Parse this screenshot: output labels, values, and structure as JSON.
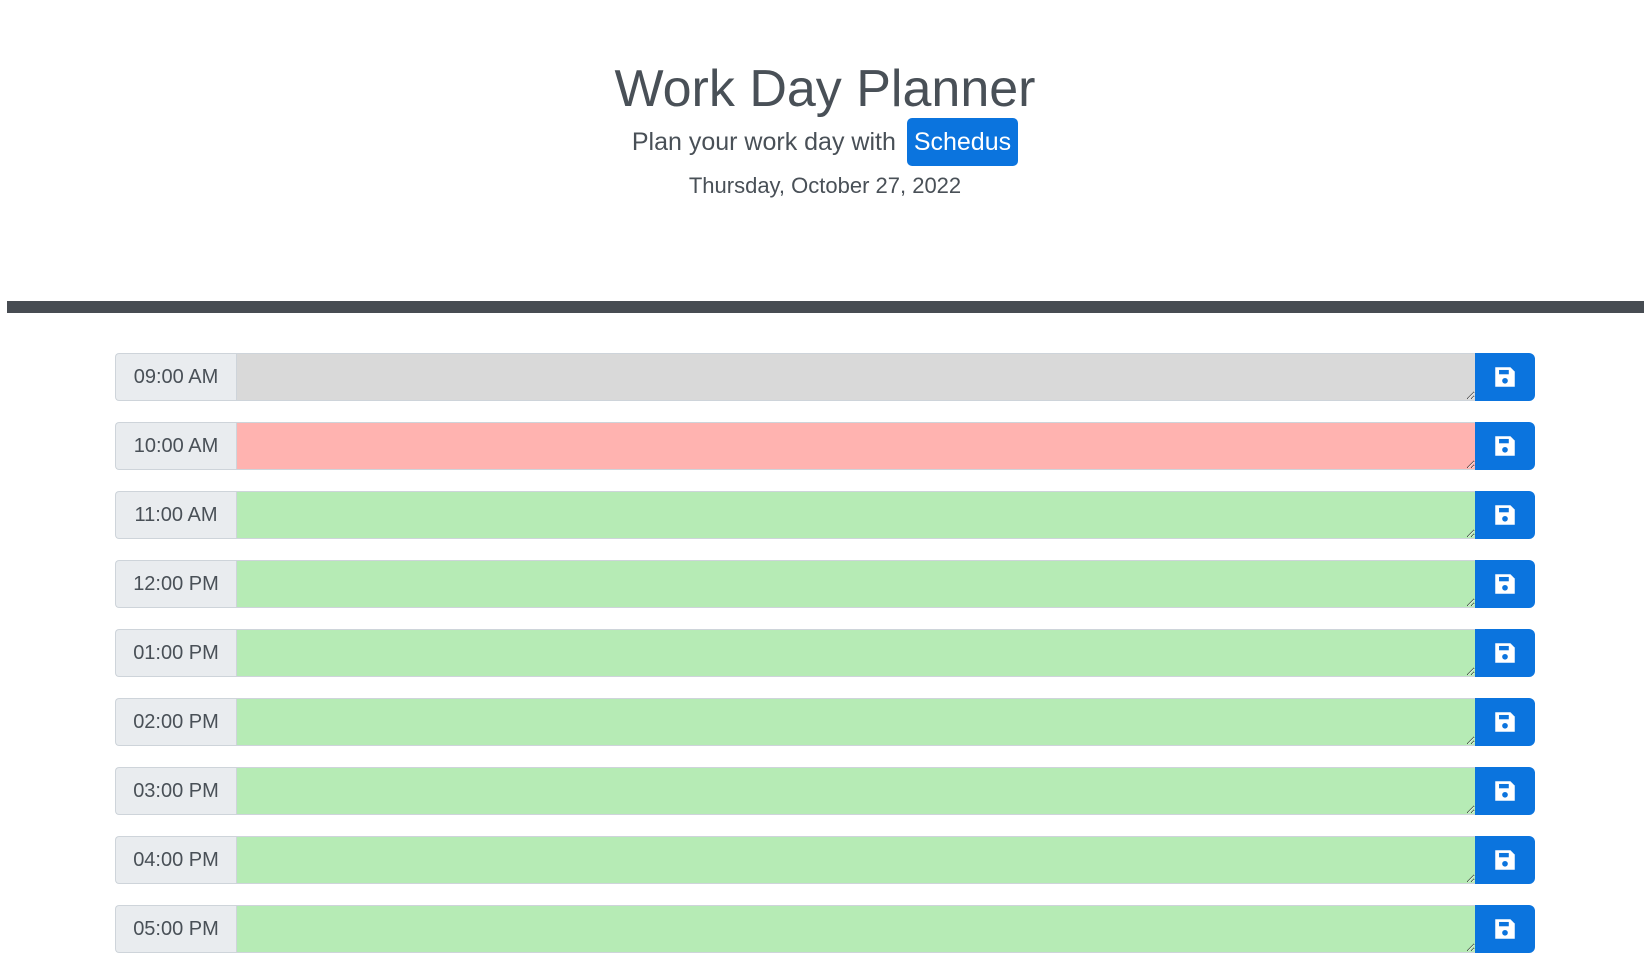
{
  "header": {
    "title": "Work Day Planner",
    "subtitle_prefix": "Plan your work day with",
    "brand": "Schedus",
    "date": "Thursday, October 27, 2022"
  },
  "colors": {
    "past": "#d9d9d9",
    "present": "#ffb3b0",
    "future": "#b6ebb5",
    "accent": "#0b74de"
  },
  "hours": [
    {
      "label": "09:00 AM",
      "status": "past",
      "text": ""
    },
    {
      "label": "10:00 AM",
      "status": "present",
      "text": ""
    },
    {
      "label": "11:00 AM",
      "status": "future",
      "text": ""
    },
    {
      "label": "12:00 PM",
      "status": "future",
      "text": ""
    },
    {
      "label": "01:00 PM",
      "status": "future",
      "text": ""
    },
    {
      "label": "02:00 PM",
      "status": "future",
      "text": ""
    },
    {
      "label": "03:00 PM",
      "status": "future",
      "text": ""
    },
    {
      "label": "04:00 PM",
      "status": "future",
      "text": ""
    },
    {
      "label": "05:00 PM",
      "status": "future",
      "text": ""
    }
  ],
  "save_icon": "save-icon"
}
